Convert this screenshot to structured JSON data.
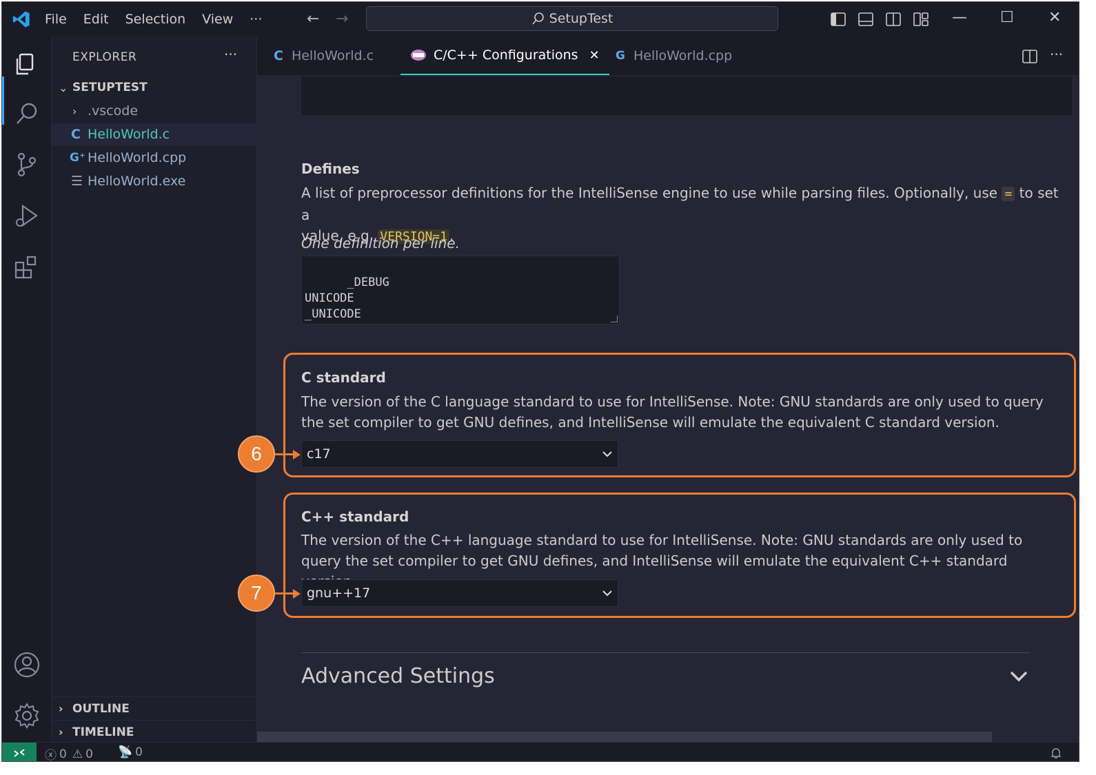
{
  "titlebar": {
    "menu": [
      "File",
      "Edit",
      "Selection",
      "View",
      "···"
    ],
    "search_text": "SetupTest"
  },
  "explorer": {
    "title": "EXPLORER",
    "more": "···",
    "folder": "SETUPTEST",
    "items": [
      {
        "label": ".vscode",
        "icon": "chevron-right-icon"
      },
      {
        "label": "HelloWorld.c",
        "icon": "c-file-icon"
      },
      {
        "label": "HelloWorld.cpp",
        "icon": "cpp-file-icon"
      },
      {
        "label": "HelloWorld.exe",
        "icon": "binary-file-icon"
      }
    ],
    "outline": "OUTLINE",
    "timeline": "TIMELINE"
  },
  "tabs": [
    {
      "label": "HelloWorld.c",
      "icon": "C"
    },
    {
      "label": "C/C++ Configurations",
      "close": "✕"
    },
    {
      "label": "HelloWorld.cpp",
      "icon": "G"
    }
  ],
  "settings": {
    "defines": {
      "title": "Defines",
      "desc_part1": "A list of preprocessor definitions for the IntelliSense engine to use while parsing files. Optionally, use",
      "eq": "=",
      "desc_part2": "to set a",
      "desc_part3": "value, e.g.",
      "example": "VERSION=1",
      "desc_part4": ".",
      "hint": "One definition per line.",
      "values": "_DEBUG\nUNICODE\n_UNICODE"
    },
    "c_standard": {
      "title": "C standard",
      "desc": "The version of the C language standard to use for IntelliSense. Note: GNU standards are only used to query the set compiler to get GNU defines, and IntelliSense will emulate the equivalent C standard version.",
      "value": "c17"
    },
    "cpp_standard": {
      "title": "C++ standard",
      "desc": "The version of the C++ language standard to use for IntelliSense. Note: GNU standards are only used to query the set compiler to get GNU defines, and IntelliSense will emulate the equivalent C++ standard version.",
      "value": "gnu++17"
    },
    "advanced": "Advanced Settings"
  },
  "annotations": [
    "6",
    "7"
  ],
  "status": {
    "errors": "0",
    "warnings": "0",
    "ports": "0"
  },
  "colors": {
    "accent_tab": "#3dd3b0",
    "annotation": "#ed7d31",
    "remote": "#16825d"
  }
}
